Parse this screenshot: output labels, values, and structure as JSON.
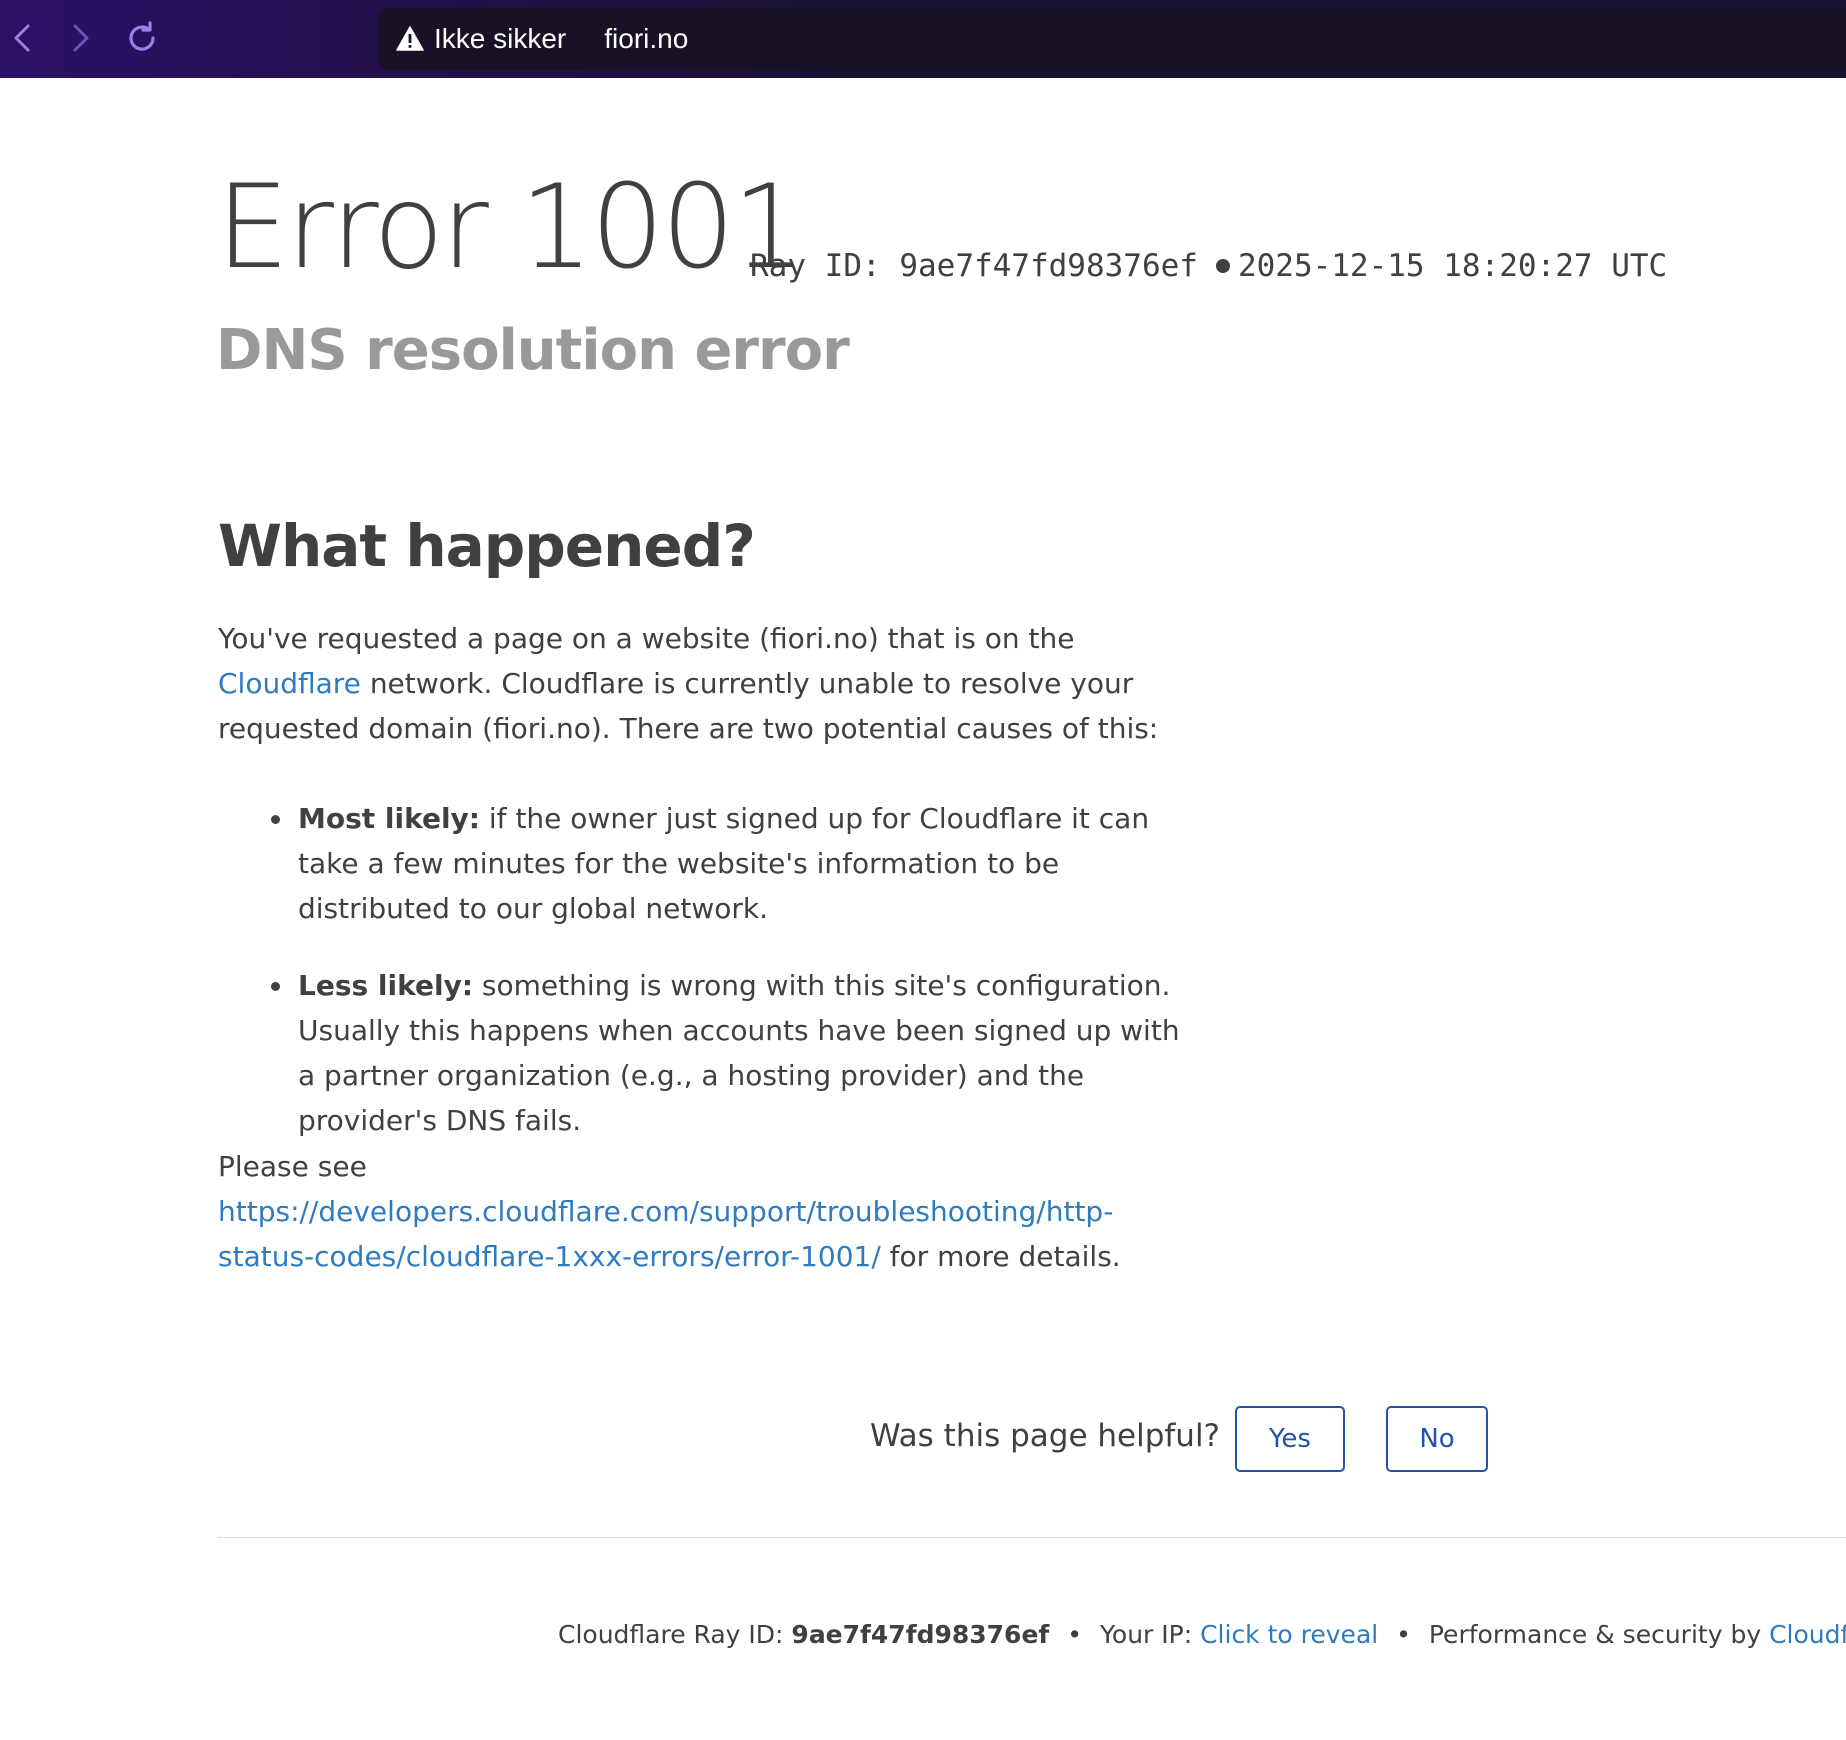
{
  "browser": {
    "security_label": "Ikke sikker",
    "host": "fiori.no"
  },
  "error": {
    "title": "Error 1001",
    "ray_prefix": "Ray ID:",
    "ray_id": "9ae7f47fd98376ef",
    "timestamp": "2025-12-15 18:20:27 UTC",
    "subtitle": "DNS resolution error"
  },
  "what_happened": {
    "heading": "What happened?",
    "intro_part1": "You've requested a page on a website (fiori.no) that is on the",
    "cloudflare_link": "Cloudflare",
    "intro_part2": "network. Cloudflare is currently unable to resolve your requested domain (fiori.no). There are two potential causes of this:",
    "causes": [
      {
        "label": "Most likely:",
        "text": "if the owner just signed up for Cloudflare it can take a few minutes for the website's information to be distributed to our global network."
      },
      {
        "label": "Less likely:",
        "text": "something is wrong with this site's configuration. Usually this happens when accounts have been signed up with a partner organization (e.g., a hosting provider) and the provider's DNS fails."
      }
    ],
    "see_prefix": "Please see",
    "docs_link": "https://developers.cloudflare.com/support/troubleshooting/http-status-codes/cloudflare-1xxx-errors/error-1001/",
    "see_suffix": "for more details."
  },
  "feedback": {
    "question": "Was this page helpful?",
    "yes": "Yes",
    "no": "No"
  },
  "footer": {
    "ray_label": "Cloudflare Ray ID:",
    "ray_id": "9ae7f47fd98376ef",
    "separator": "•",
    "ip_label": "Your IP:",
    "ip_link": "Click to reveal",
    "perf_label": "Performance & security by",
    "brand_link": "Cloudflare"
  },
  "colors": {
    "link": "#2f7bbf",
    "button_border": "#2253a4",
    "text": "#404040",
    "subtitle": "#999999",
    "topbar": "#2b1167"
  }
}
